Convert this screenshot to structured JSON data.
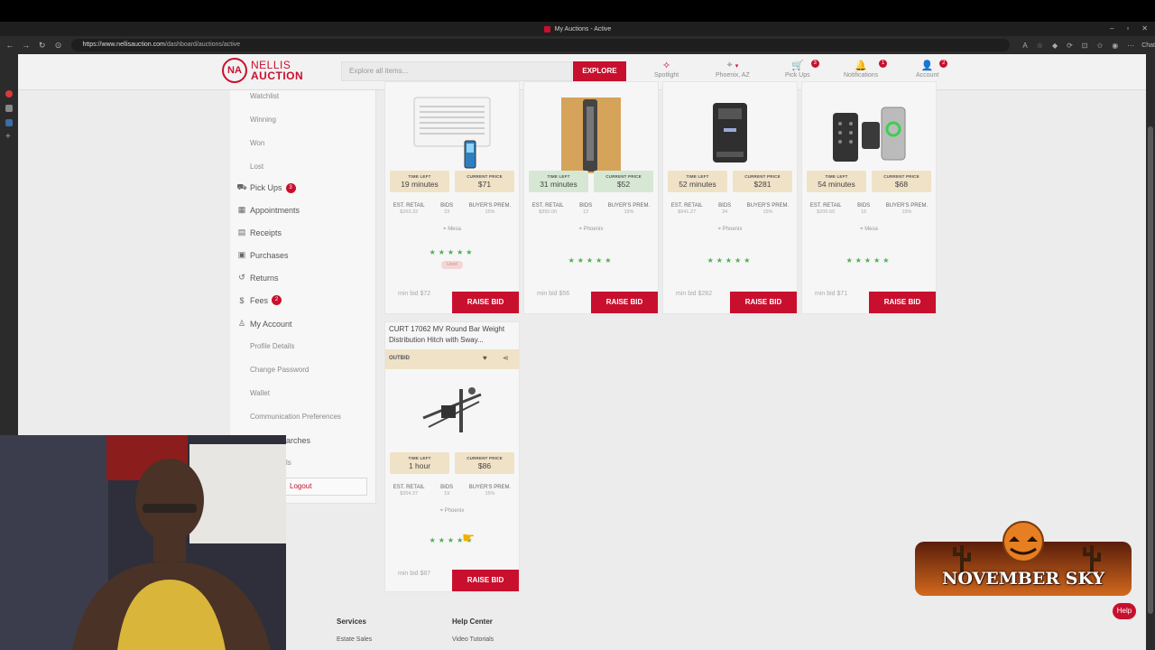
{
  "browser": {
    "window_title": "My Auctions - Active",
    "url_host": "https://www.nellisauction.com",
    "url_path": "/dashboard/auctions/active",
    "chat_label": "Chat"
  },
  "header": {
    "logo_mark": "NA",
    "logo_line1": "NELLIS",
    "logo_line2": "AUCTION",
    "search_placeholder": "Explore all items...",
    "explore_label": "EXPLORE",
    "nav": {
      "spotlight": "Spotlight",
      "location": "Phoenix, AZ",
      "pickups": "Pick Ups",
      "pickups_count": "3",
      "notifications": "Notifications",
      "notifications_count": "1",
      "account": "Account",
      "account_count": "2"
    }
  },
  "sidebar": {
    "sub_auctions": [
      "Watchlist",
      "Winning",
      "Won",
      "Lost"
    ],
    "pickups": "Pick Ups",
    "pickups_badge": "3",
    "appointments": "Appointments",
    "receipts": "Receipts",
    "purchases": "Purchases",
    "returns": "Returns",
    "fees": "Fees",
    "fees_badge": "2",
    "my_account": "My Account",
    "sub_account": [
      "Profile Details",
      "Change Password",
      "Wallet",
      "Communication Preferences"
    ],
    "partial1": "arches",
    "partial2": "ls",
    "logout": "Logout"
  },
  "labels": {
    "time_left": "TIME LEFT",
    "current_price": "CURRENT PRICE",
    "est_retail": "EST. RETAIL",
    "bids": "BIDS",
    "buyers_prem": "BUYER'S PREM.",
    "raise_bid": "RAISE BID",
    "stars": "★★★★★"
  },
  "cards": [
    {
      "time_left": "19 minutes",
      "price": "$71",
      "retail": "$263.32",
      "bids": "23",
      "prem": "15%",
      "location": "Mesa",
      "condition": "Used",
      "min_bid": "min bid $72"
    },
    {
      "time_left": "31 minutes",
      "price": "$52",
      "retail": "$350.00",
      "bids": "12",
      "prem": "15%",
      "location": "Phoenix",
      "min_bid": "min bid $56"
    },
    {
      "time_left": "52 minutes",
      "price": "$281",
      "retail": "$941.27",
      "bids": "34",
      "prem": "15%",
      "location": "Phoenix",
      "min_bid": "min bid $282"
    },
    {
      "time_left": "54 minutes",
      "price": "$68",
      "retail": "$200.60",
      "bids": "16",
      "prem": "15%",
      "location": "Mesa",
      "min_bid": "min bid $71"
    },
    {
      "title": "CURT 17062 MV Round Bar Weight Distribution Hitch with Sway...",
      "status": "OUTBID",
      "time_left": "1 hour",
      "price": "$86",
      "retail": "$354.37",
      "bids": "19",
      "prem": "15%",
      "location": "Phoenix",
      "min_bid": "min bid $87"
    }
  ],
  "footer": {
    "services": "Services",
    "estate_sales": "Estate Sales",
    "help_center": "Help Center",
    "video_tutorials": "Video Tutorials"
  },
  "overlay": {
    "banner_text": "NOVEMBER SKY",
    "help": "Help"
  },
  "colors": {
    "brand_red": "#c8102e",
    "star_green": "#4caf50",
    "time_left_bg": "#efe2c7",
    "price_bg": "#d6e8d4"
  }
}
